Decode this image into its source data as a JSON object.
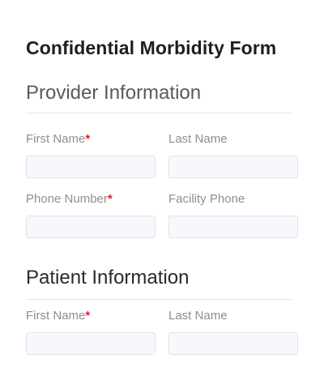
{
  "form": {
    "title": "Confidential Morbidity Form"
  },
  "sections": {
    "provider": {
      "title": "Provider Information",
      "fields": {
        "first_name": {
          "label": "First Name",
          "required_mark": "*",
          "value": ""
        },
        "last_name": {
          "label": "Last Name",
          "value": ""
        },
        "phone_number": {
          "label": "Phone Number",
          "required_mark": "*",
          "value": ""
        },
        "facility_phone": {
          "label": "Facility Phone",
          "value": ""
        }
      }
    },
    "patient": {
      "title": "Patient Information",
      "fields": {
        "first_name": {
          "label": "First Name",
          "required_mark": "*",
          "value": ""
        },
        "last_name": {
          "label": "Last Name",
          "value": ""
        }
      }
    }
  },
  "colors": {
    "required_mark": "#e0202a",
    "input_background": "#f6f8fb",
    "input_border": "#dbe5f1",
    "label_text": "#8e8e8e"
  }
}
